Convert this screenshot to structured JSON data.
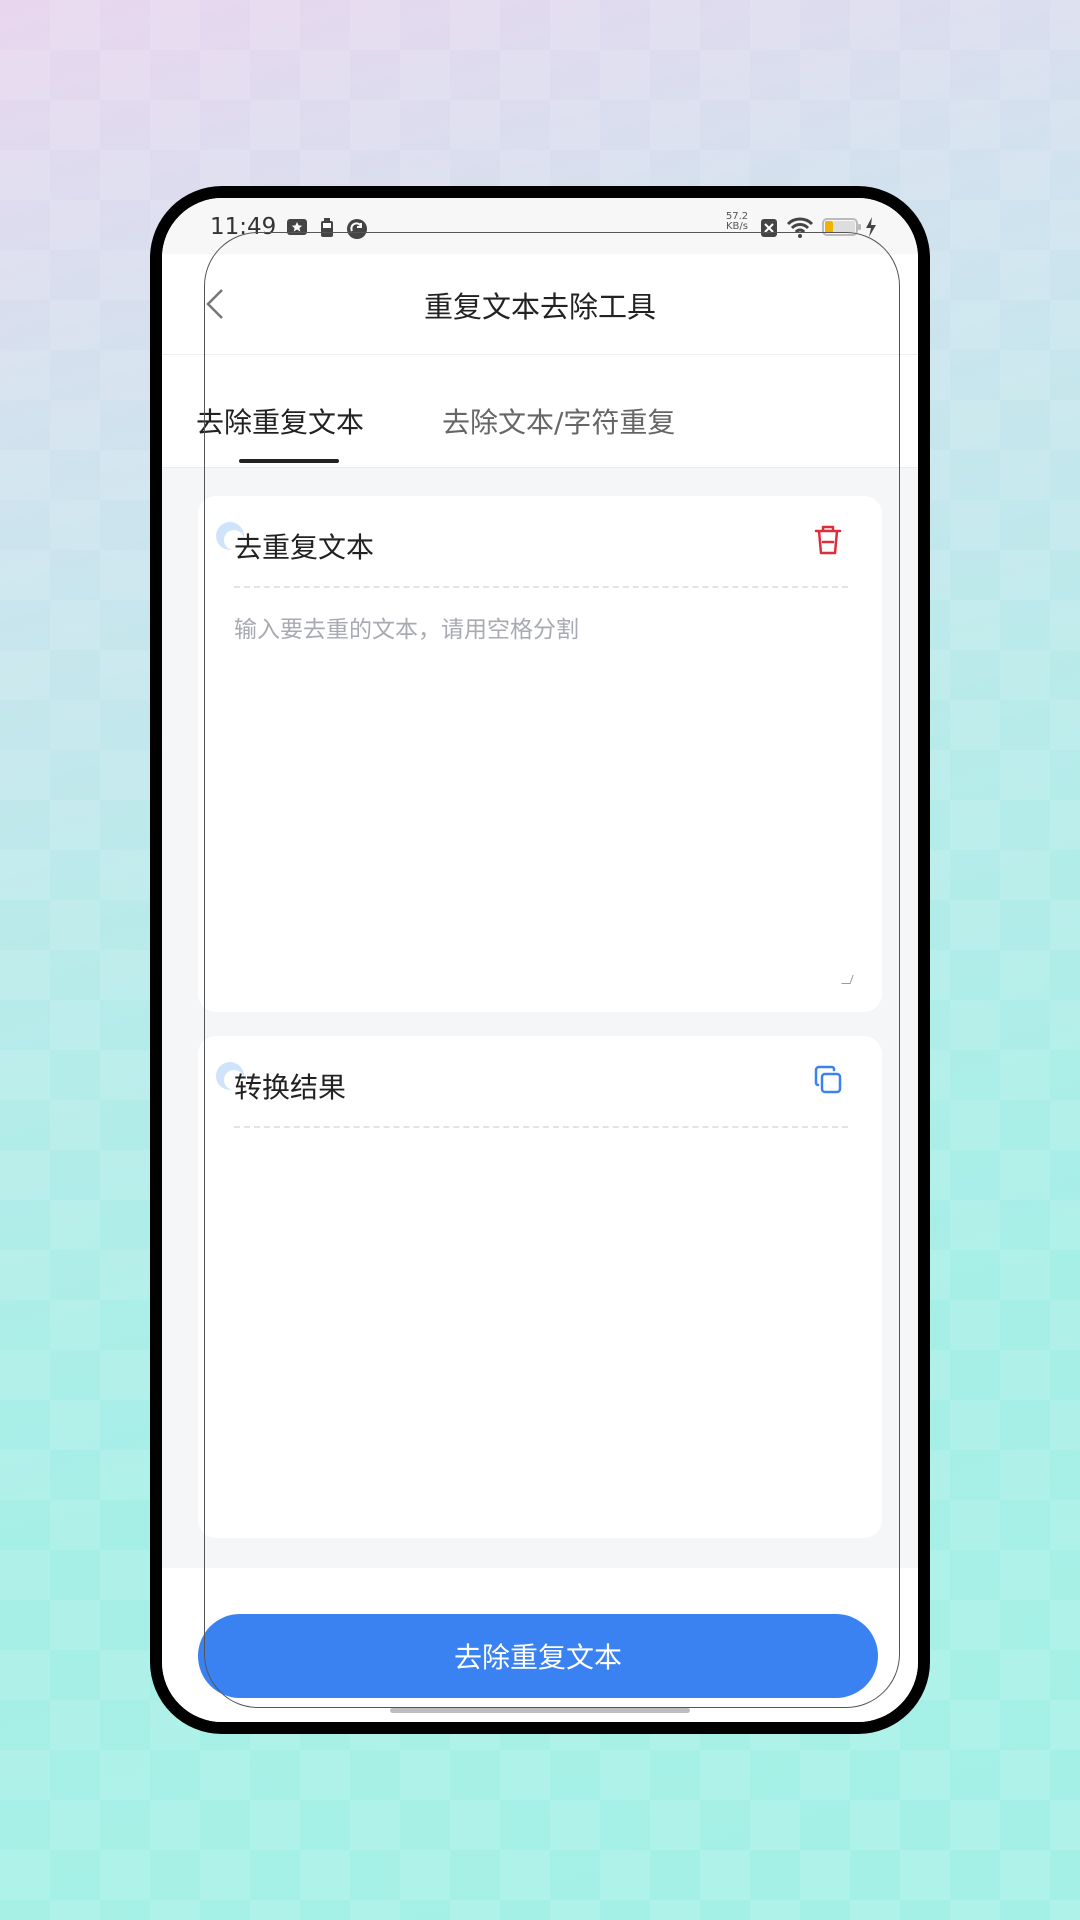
{
  "status_bar": {
    "time": "11:49",
    "net_speed_value": "57.2",
    "net_speed_unit": "KB/s",
    "icons": [
      "notification-icon",
      "battery-saver-icon",
      "sync-icon",
      "sim-x-icon",
      "wifi-icon",
      "battery-icon",
      "charging-icon"
    ]
  },
  "nav": {
    "title": "重复文本去除工具",
    "back_icon": "chevron-left-icon"
  },
  "tabs": [
    {
      "label": "去除重复文本",
      "active": true
    },
    {
      "label": "去除文本/字符重复",
      "active": false
    }
  ],
  "input_card": {
    "title": "去重复文本",
    "placeholder": "输入要去重的文本，请用空格分割",
    "value": "",
    "action_icon": "trash-icon"
  },
  "result_card": {
    "title": "转换结果",
    "value": "",
    "action_icon": "copy-icon"
  },
  "primary_button": {
    "label": "去除重复文本"
  },
  "colors": {
    "primary": "#3a82f2",
    "delete": "#e02d3a",
    "copy": "#3a82f2",
    "accent_light": "#cfe3fb"
  }
}
